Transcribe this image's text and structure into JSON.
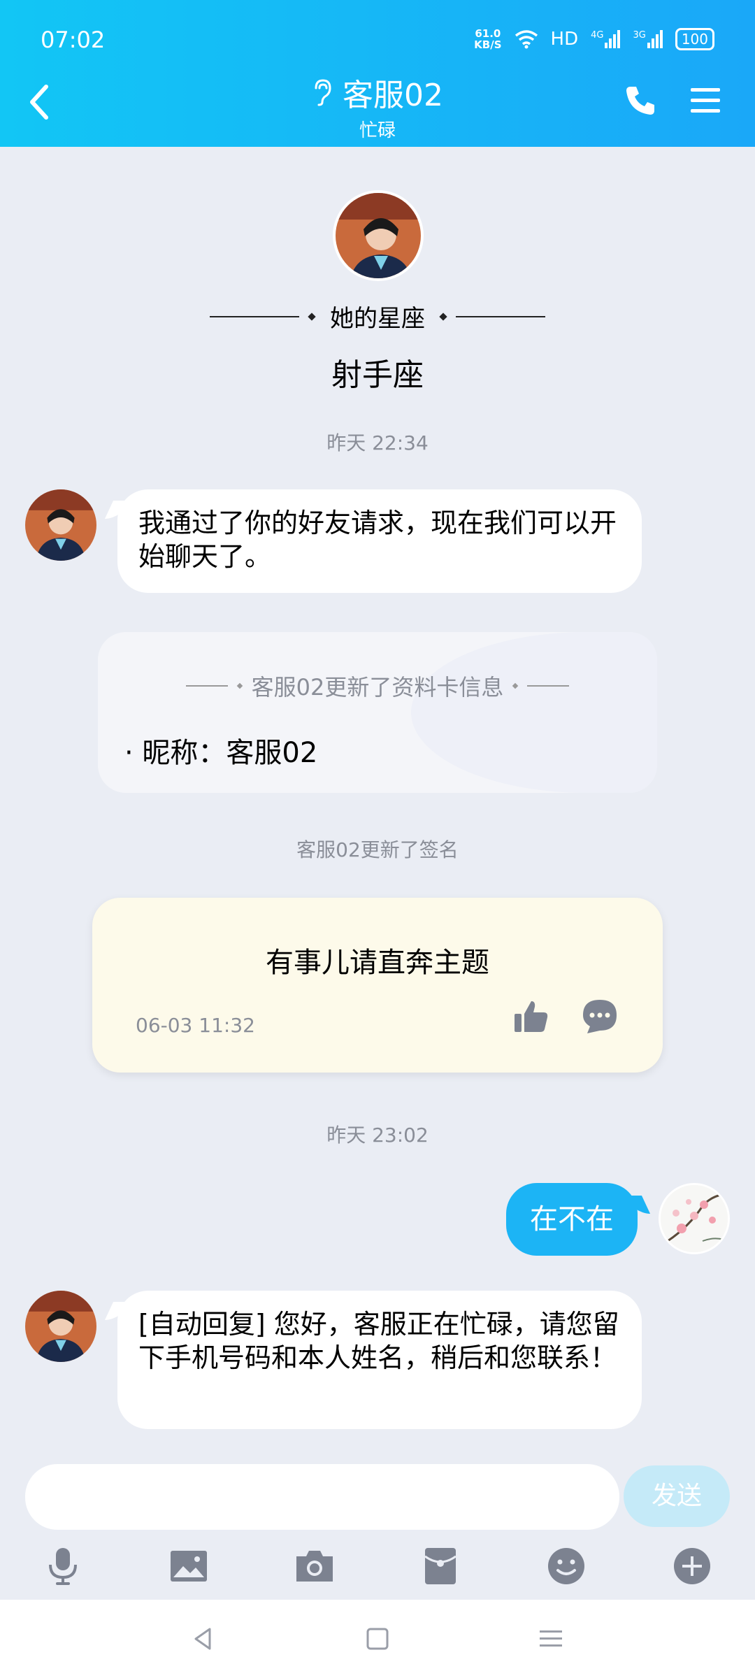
{
  "status_bar": {
    "time": "07:02",
    "net_speed_value": "61.0",
    "net_speed_unit": "KB/S",
    "hd_label": "HD",
    "signal1": "4G",
    "signal2": "3G",
    "battery": "100"
  },
  "header": {
    "title": "客服02",
    "subtitle": "忙碌"
  },
  "profile": {
    "constellation_label": "她的星座",
    "constellation_value": "射手座"
  },
  "messages": {
    "ts1": "昨天 22:34",
    "msg1": "我通过了你的好友请求，现在我们可以开始聊天了。",
    "card_title": "客服02更新了资料卡信息",
    "card_item": "· 昵称：客服02",
    "sig_notice": "客服02更新了签名",
    "sig_text": "有事儿请直奔主题",
    "sig_date": "06-03 11:32",
    "ts2": "昨天 23:02",
    "msg_out": "在不在",
    "msg2": "[自动回复] 您好，客服正在忙碌，请您留下手机号码和本人姓名，稍后和您联系！"
  },
  "input": {
    "placeholder": "",
    "send_label": "发送"
  },
  "colors": {
    "header_start": "#12c6f5",
    "header_end": "#1aa8f8",
    "bubble_out": "#1cb4f5",
    "background": "#eaedf4",
    "sig_card": "#fdfaea"
  },
  "icons": [
    "back-icon",
    "ear-icon",
    "phone-icon",
    "menu-icon",
    "thumbs-up-icon",
    "comment-icon",
    "mic-icon",
    "image-icon",
    "camera-icon",
    "red-packet-icon",
    "emoji-icon",
    "plus-icon"
  ]
}
